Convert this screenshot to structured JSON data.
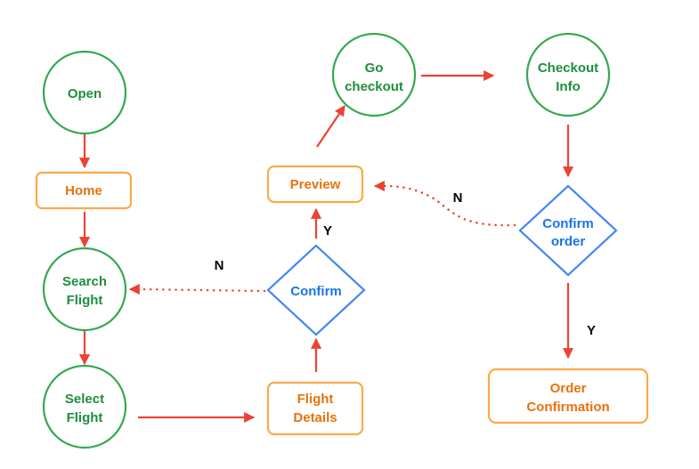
{
  "nodes": {
    "open": {
      "lines": [
        "Open"
      ],
      "shape": "circle"
    },
    "home": {
      "lines": [
        "Home"
      ],
      "shape": "rounded-rect"
    },
    "search_flight": {
      "lines": [
        "Search",
        "Flight"
      ],
      "shape": "circle"
    },
    "select_flight": {
      "lines": [
        "Select",
        "Flight"
      ],
      "shape": "circle"
    },
    "flight_details": {
      "lines": [
        "Flight",
        "Details"
      ],
      "shape": "rounded-rect"
    },
    "confirm": {
      "lines": [
        "Confirm"
      ],
      "shape": "diamond"
    },
    "preview": {
      "lines": [
        "Preview"
      ],
      "shape": "rounded-rect"
    },
    "go_checkout": {
      "lines": [
        "Go",
        "checkout"
      ],
      "shape": "circle"
    },
    "checkout_info": {
      "lines": [
        "Checkout",
        "Info"
      ],
      "shape": "circle"
    },
    "confirm_order": {
      "lines": [
        "Confirm",
        "order"
      ],
      "shape": "diamond"
    },
    "order_confirmation": {
      "lines": [
        "Order",
        "Confirmation"
      ],
      "shape": "rounded-rect"
    }
  },
  "edge_labels": {
    "confirm_yes": "Y",
    "confirm_no": "N",
    "confirm_order_yes": "Y",
    "confirm_order_no": "N"
  },
  "colors": {
    "circle": "#34a853",
    "rect": "#f9ab4a",
    "diamond": "#4285f4",
    "arrow": "#ea4335"
  }
}
